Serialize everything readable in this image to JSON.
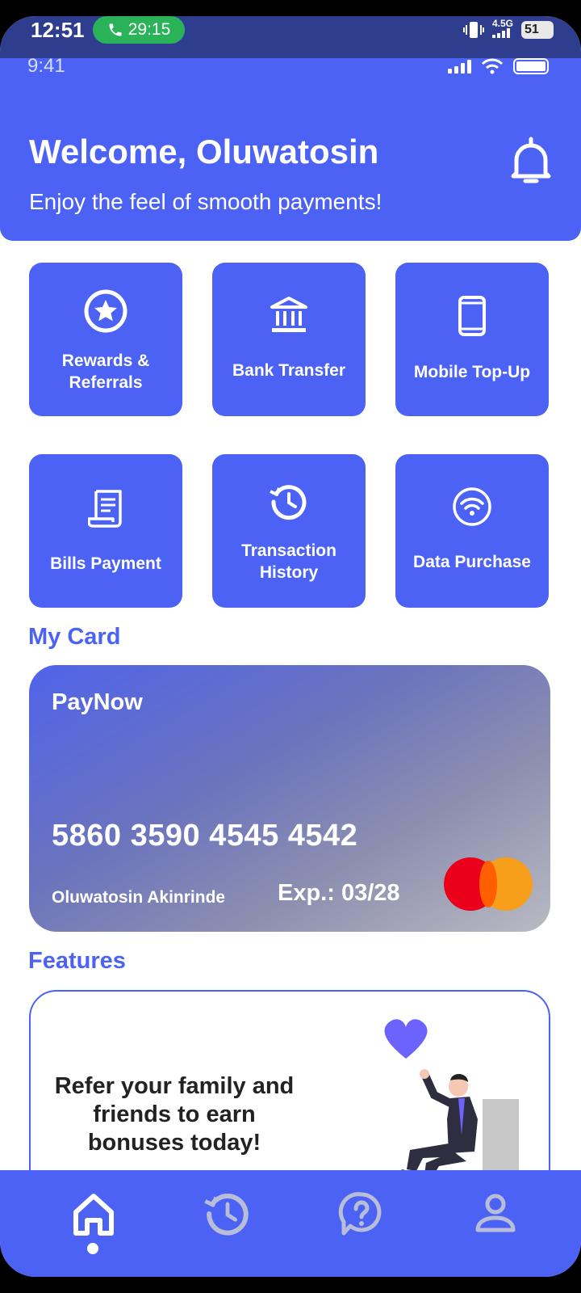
{
  "system_status": {
    "time": "12:51",
    "call_timer": "29:15",
    "network_label": "4.5G",
    "battery_level": "51"
  },
  "header": {
    "mock_time": "9:41",
    "welcome": "Welcome, Oluwatosin",
    "subtitle": "Enjoy the feel of smooth payments!"
  },
  "quick_actions": [
    {
      "label": "Rewards &\nReferrals",
      "icon": "star-circle-icon"
    },
    {
      "label": "Bank Transfer",
      "icon": "bank-icon"
    },
    {
      "label": "Mobile Top-Up",
      "icon": "mobile-phone-icon"
    },
    {
      "label": "Bills Payment",
      "icon": "receipt-icon"
    },
    {
      "label": "Transaction\nHistory",
      "icon": "history-icon"
    },
    {
      "label": "Data Purchase",
      "icon": "wifi-icon"
    }
  ],
  "my_card": {
    "section_title": "My Card",
    "brand": "PayNow",
    "number": "5860 3590 4545 4542",
    "holder": "Oluwatosin Akinrinde",
    "expiry": "Exp.: 03/28",
    "network": "mastercard-logo"
  },
  "features": {
    "section_title": "Features",
    "promo_text": "Refer your family and friends to earn bonuses today!"
  },
  "bottom_nav": [
    {
      "name": "home",
      "icon": "home-icon",
      "active": true
    },
    {
      "name": "history",
      "icon": "history-icon",
      "active": false
    },
    {
      "name": "help",
      "icon": "help-icon",
      "active": false
    },
    {
      "name": "profile",
      "icon": "profile-icon",
      "active": false
    }
  ],
  "colors": {
    "primary": "#4b62f4",
    "status_bar": "#2f3d8f",
    "call_pill": "#2bb35a",
    "inactive_nav_icon": "#b8bdd8"
  }
}
